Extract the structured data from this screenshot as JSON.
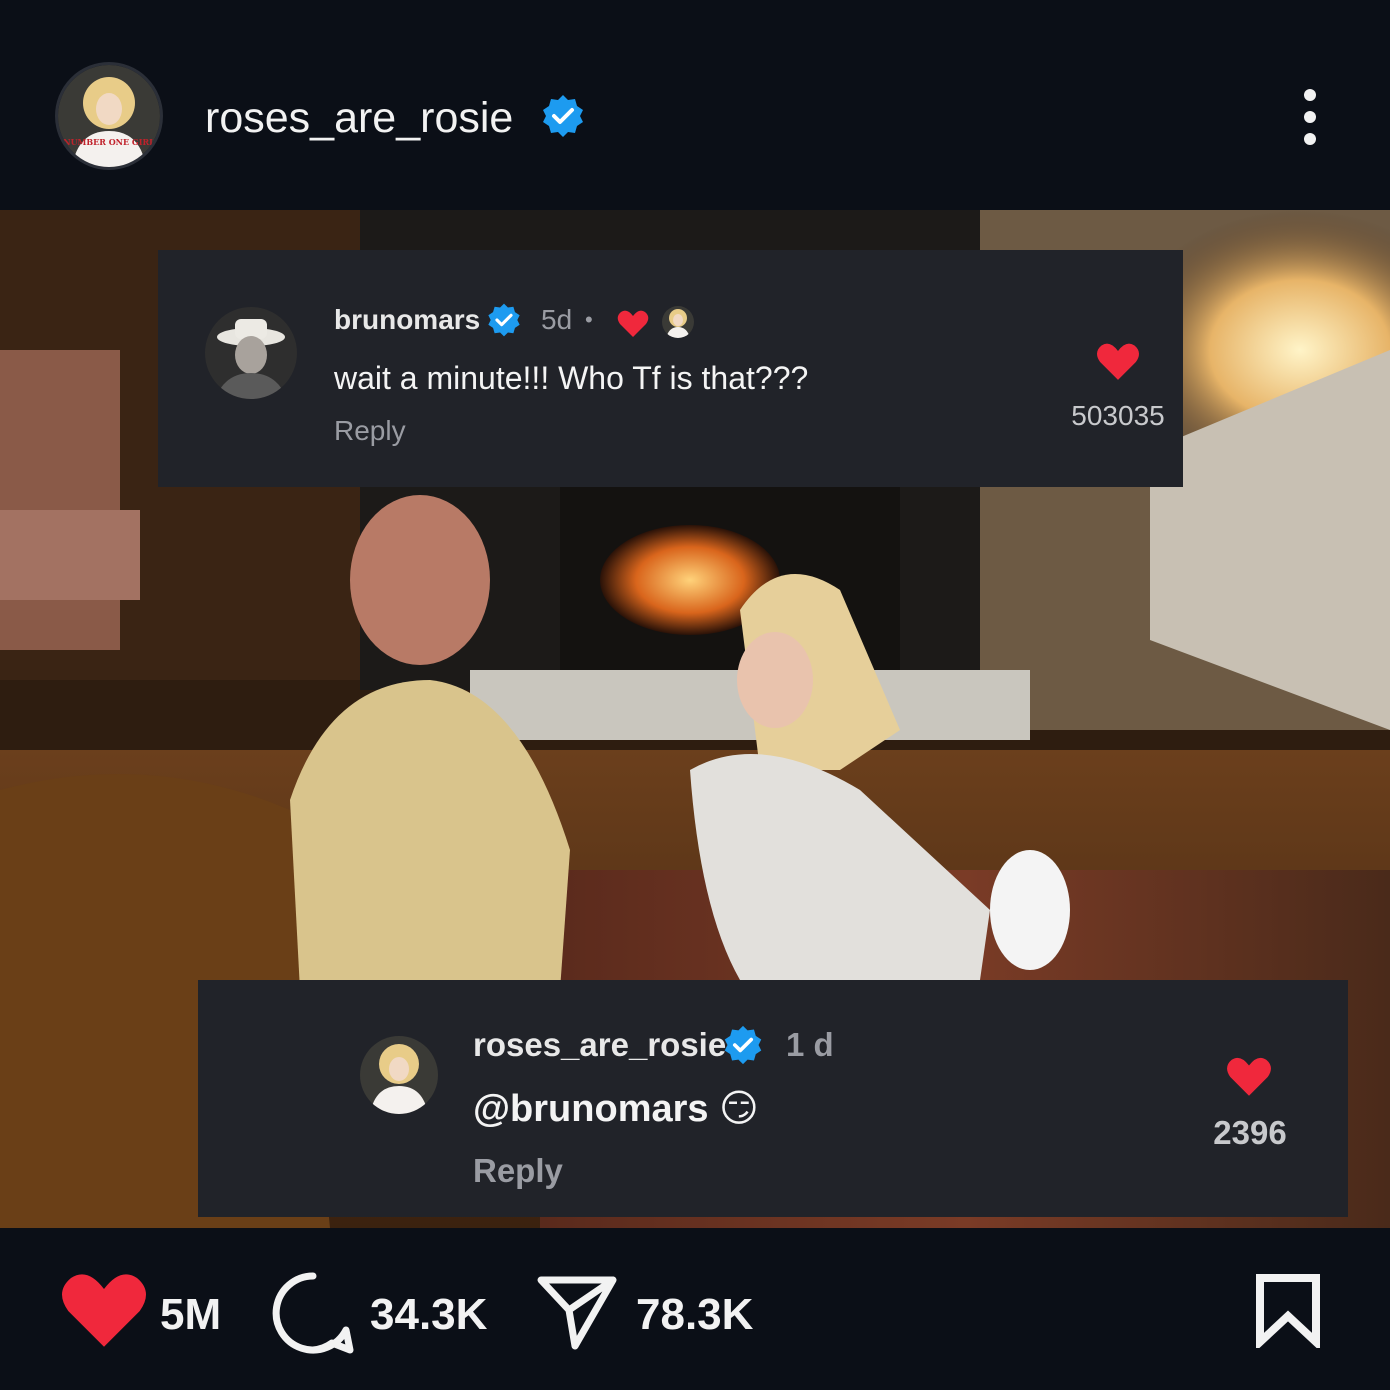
{
  "header": {
    "username": "roses_are_rosie",
    "avatar_shirt_text": "NUMBER ONE GIRL"
  },
  "comments": [
    {
      "username": "brunomars",
      "time": "5d",
      "separator": "•",
      "text": "wait a minute!!! Who Tf is that???",
      "reply_label": "Reply",
      "likes": "503035"
    },
    {
      "username": "roses_are_rosie",
      "time": "1 d",
      "text": "@brunomars 😏",
      "reply_label": "Reply",
      "likes": "2396"
    }
  ],
  "actions": {
    "likes": "5M",
    "comments": "34.3K",
    "shares": "78.3K"
  },
  "colors": {
    "background": "#0b0f17",
    "card": "#212329",
    "heart": "#f0283c",
    "verified": "#1d9bf0"
  },
  "icons": [
    "verified-badge-icon",
    "more-options-icon",
    "heart-icon",
    "comment-icon",
    "share-icon",
    "bookmark-icon"
  ]
}
